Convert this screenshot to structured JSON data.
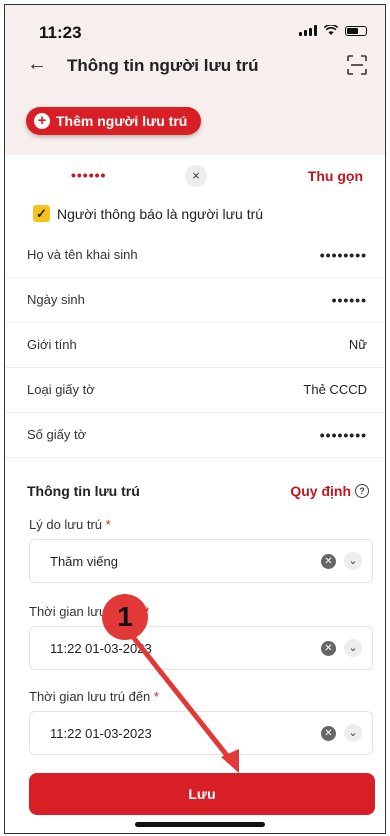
{
  "status_bar": {
    "time": "11:23"
  },
  "header": {
    "title": "Thông tin người lưu trú",
    "back_icon": "arrow-left-icon",
    "scan_icon": "scan-icon"
  },
  "add_button": {
    "label": "Thêm người lưu trú"
  },
  "person": {
    "chip_value": "••••••",
    "clear_symbol": "×",
    "collapse_label": "Thu gọn"
  },
  "checkbox": {
    "checked": true,
    "label": "Người thông báo là người lưu trú"
  },
  "info_rows": [
    {
      "label": "Họ và tên khai sinh",
      "value": "••••••••"
    },
    {
      "label": "Ngày sinh",
      "value": "••••••"
    },
    {
      "label": "Giới tính",
      "value": "Nữ"
    },
    {
      "label": "Loại giấy tờ",
      "value": "Thẻ CCCD"
    },
    {
      "label": "Số giấy tờ",
      "value": "••••••••"
    }
  ],
  "stay_section": {
    "title": "Thông tin lưu trú",
    "rule_label": "Quy định",
    "fields": [
      {
        "label": "Lý do lưu trú",
        "required_mark": "*",
        "value": "Thăm viếng"
      },
      {
        "label": "Thời gian lưu trú từ",
        "required_mark": "*",
        "value": "11:22 01-03-2023"
      },
      {
        "label": "Thời gian lưu trú đến",
        "required_mark": "*",
        "value": "11:22 01-03-2023"
      }
    ]
  },
  "save_button": {
    "label": "Lưu"
  },
  "annotation": {
    "number": "1"
  },
  "colors": {
    "brand_red": "#d81f26",
    "checkbox_yellow": "#f6c21c",
    "header_bg": "#f7eeee"
  }
}
